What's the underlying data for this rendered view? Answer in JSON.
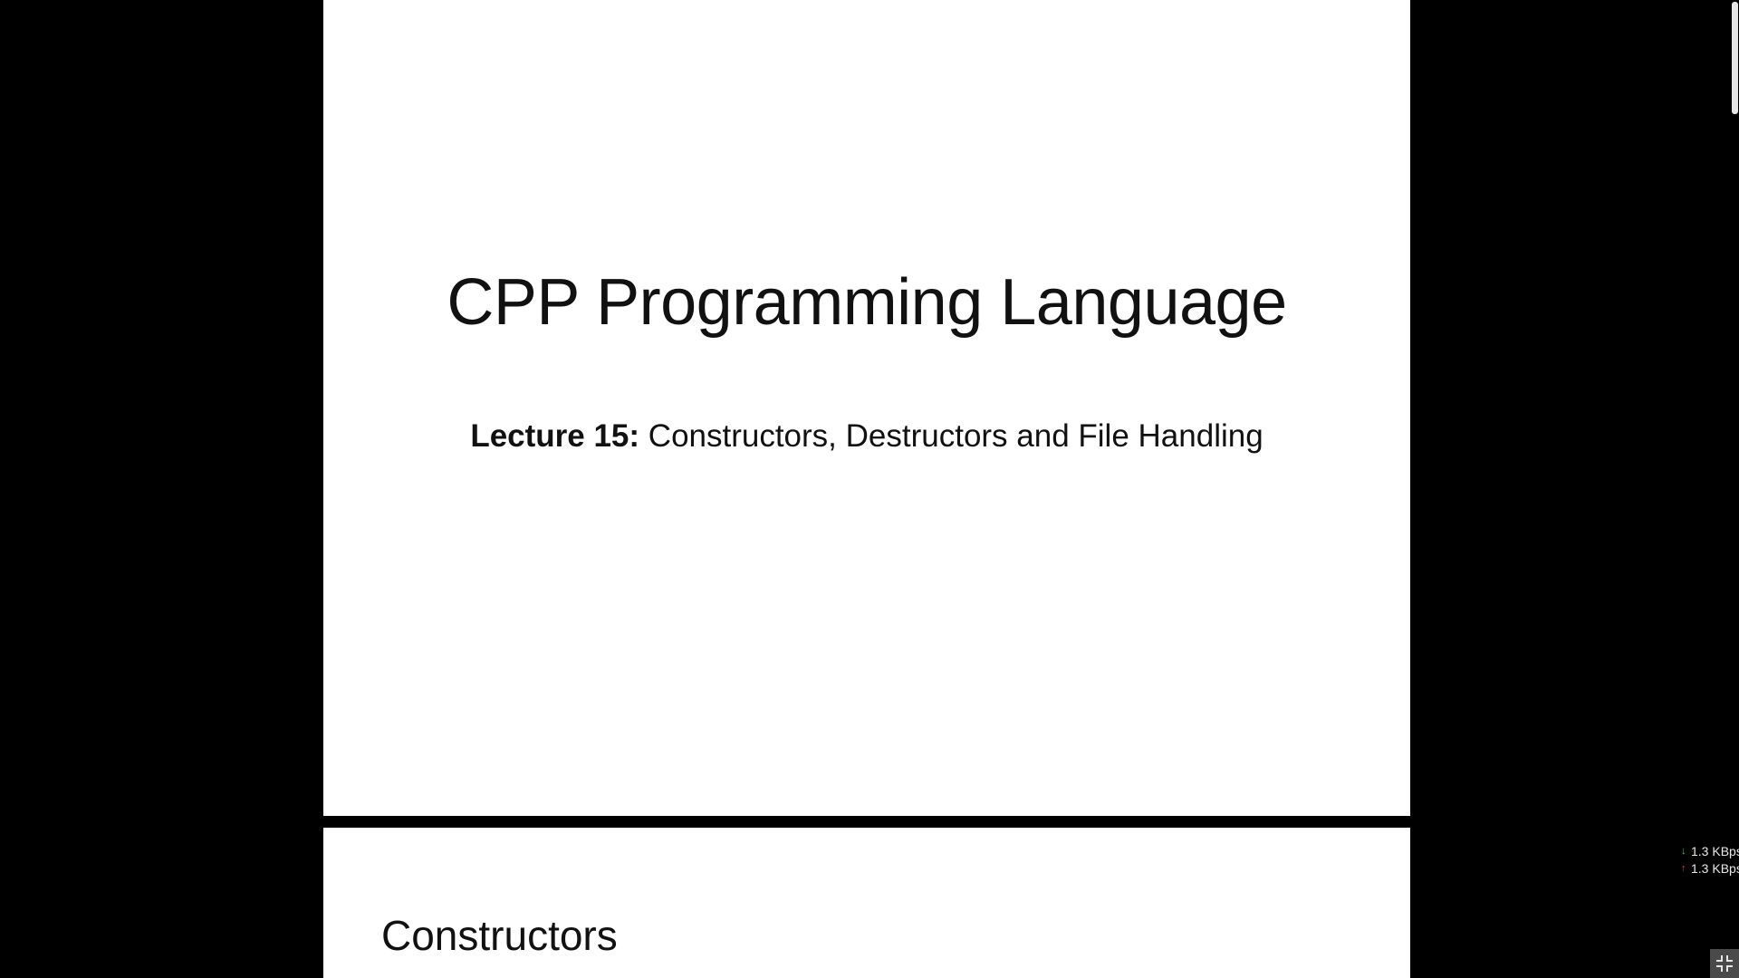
{
  "slides": [
    {
      "title": "CPP Programming Language",
      "subtitle_bold": "Lecture 15:",
      "subtitle_rest": " Constructors, Destructors and File Handling"
    },
    {
      "heading": "Constructors"
    }
  ],
  "network": {
    "download": "1.3 KBps",
    "upload": "1.3 KBps",
    "download_color": "#49c549",
    "upload_color": "#e0413a"
  },
  "icons": {
    "download_arrow": "arrow-down-icon",
    "upload_arrow": "arrow-up-icon",
    "exit_fullscreen": "exit-fullscreen-icon"
  },
  "colors": {
    "background": "#000000",
    "slide": "#ffffff",
    "text": "#111111"
  }
}
